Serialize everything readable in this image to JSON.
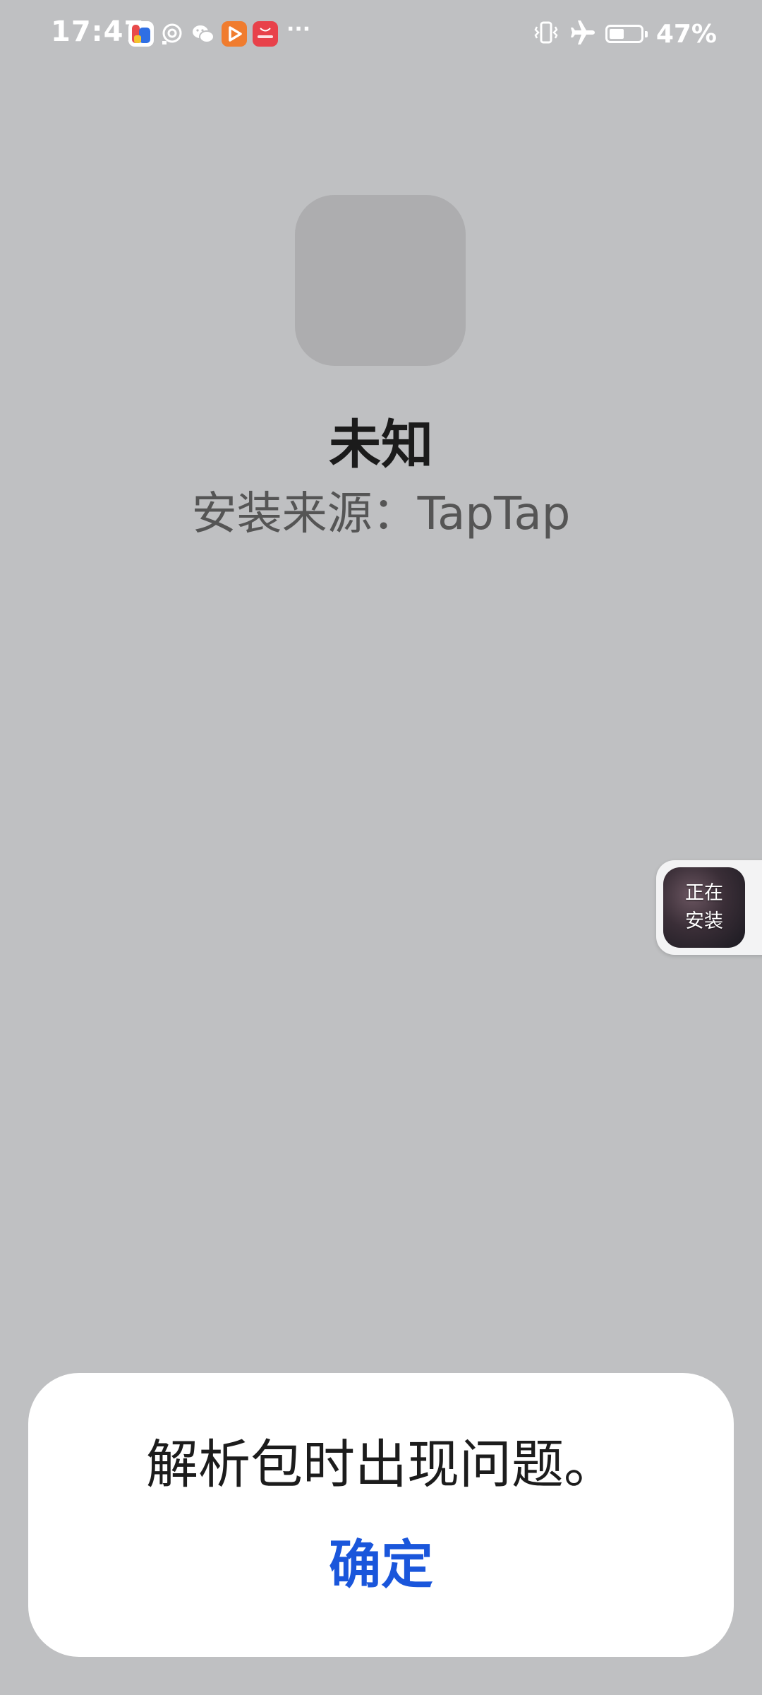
{
  "status_bar": {
    "time": "17:47",
    "battery_percent": "47%",
    "battery_level": 0.47,
    "notification_icons": [
      "family-app-icon",
      "lens-app-icon",
      "wechat-icon",
      "video-app-icon",
      "huawei-store-icon"
    ],
    "more_indicator": "···",
    "right_icons": [
      "vibrate-icon",
      "airplane-mode-icon",
      "battery-icon"
    ]
  },
  "app": {
    "name": "未知",
    "install_source": "安装来源：TapTap"
  },
  "floating_bubble": {
    "line1": "正在",
    "line2": "安装"
  },
  "dialog": {
    "message": "解析包时出现问题。",
    "confirm_label": "确定"
  },
  "colors": {
    "background": "#bfc0c2",
    "accent": "#1a56db",
    "dialog_bg": "#ffffff"
  }
}
